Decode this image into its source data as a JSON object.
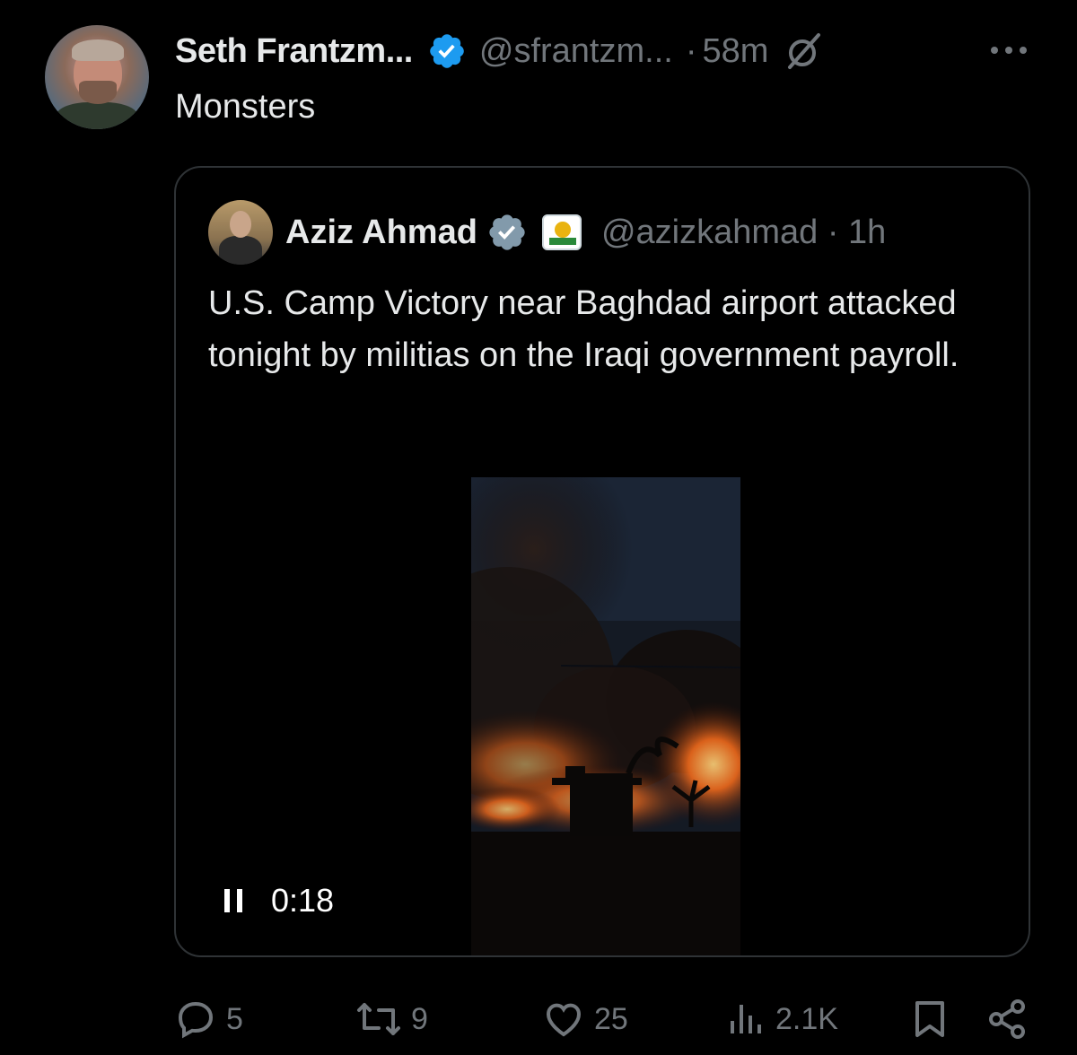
{
  "tweet": {
    "author_name": "Seth Frantzm...",
    "author_handle": "@sfrantzm...",
    "separator": "·",
    "time": "58m",
    "text": "Monsters"
  },
  "quoted_tweet": {
    "author_name": "Aziz Ahmad",
    "author_handle": "@azizkahmad · 1h",
    "text": "U.S. Camp Victory near Baghdad airport attacked tonight by militias on the Iraqi government payroll.",
    "video": {
      "state": "playing",
      "timestamp": "0:18"
    }
  },
  "actions": {
    "reply_count": "5",
    "retweet_count": "9",
    "like_count": "25",
    "views_count": "2.1K"
  },
  "icons": {
    "verified": "verified-badge-icon",
    "grok": "grok-icon",
    "more": "more-icon",
    "affiliate": "affiliate-badge-icon",
    "pause": "pause-icon",
    "reply": "reply-icon",
    "retweet": "retweet-icon",
    "like": "heart-icon",
    "views": "views-icon",
    "bookmark": "bookmark-icon",
    "share": "share-icon"
  },
  "colors": {
    "background": "#000000",
    "primary_text": "#e7e9ea",
    "secondary_text": "#71767b",
    "border": "#2f3336",
    "verified_blue": "#1d9bf0",
    "verified_gray": "#829aab"
  }
}
